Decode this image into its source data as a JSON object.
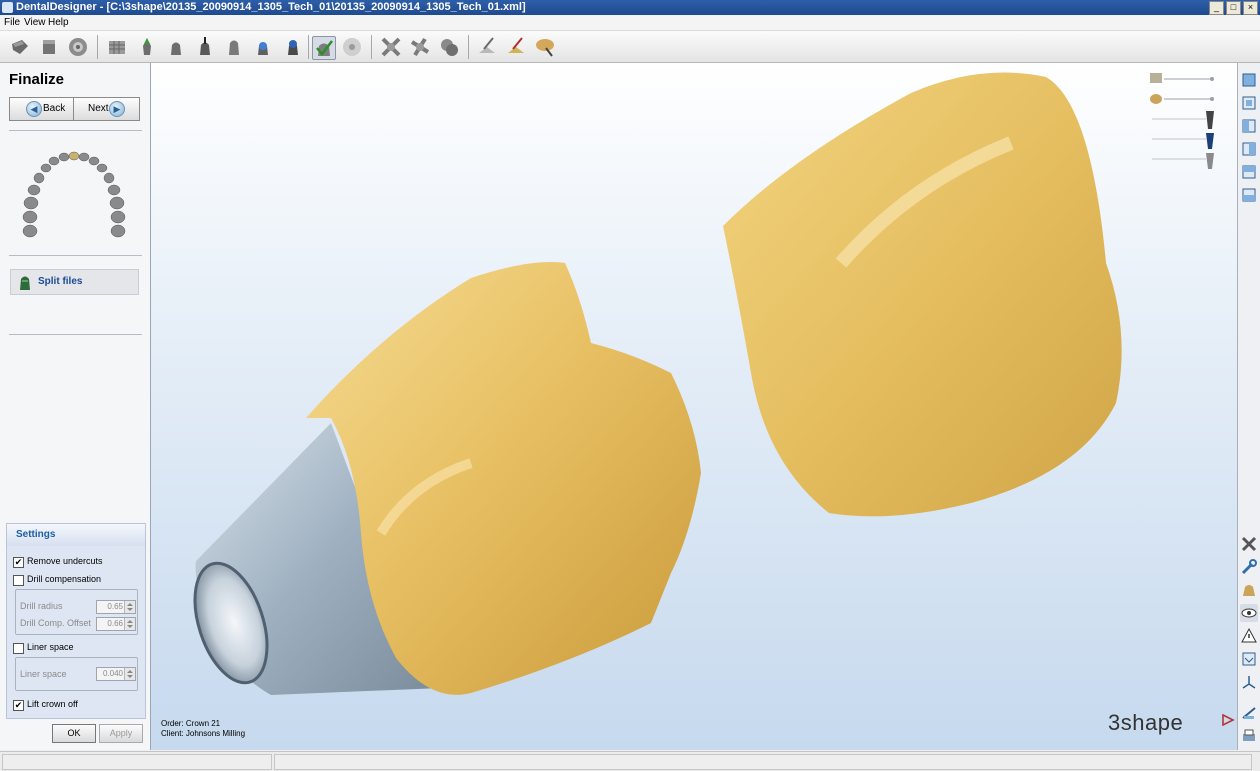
{
  "window": {
    "title": "DentalDesigner - [C:\\3shape\\20135_20090914_1305_Tech_01\\20135_20090914_1305_Tech_01.xml]",
    "buttons": [
      "_",
      "□",
      "×"
    ]
  },
  "menu": [
    "File",
    "View",
    "Help"
  ],
  "toolbar": {
    "icons": [
      "order-icon",
      "model-icon",
      "scan-icon",
      "grid-icon",
      "margin-icon",
      "die-icon",
      "insertion-icon",
      "coping-icon",
      "abutment-icon",
      "cap-icon",
      "finalize-check-icon",
      "disc-icon",
      "gear-icon-1",
      "gear-icon-2",
      "gear-icon-3",
      "tool-icon-1",
      "tool-icon-2",
      "tool-icon-3"
    ]
  },
  "left_panel": {
    "title": "Finalize",
    "back_label": "Back",
    "next_label": "Next",
    "split_files_label": "Split files"
  },
  "settings": {
    "title": "Settings",
    "remove_undercuts": {
      "label": "Remove undercuts",
      "checked": true
    },
    "drill_compensation": {
      "label": "Drill compensation",
      "checked": false
    },
    "drill_radius": {
      "label": "Drill radius",
      "value": "0.65"
    },
    "drill_comp_offset": {
      "label": "Drill Comp. Offset",
      "value": "0.66"
    },
    "liner_space_check": {
      "label": "Liner space",
      "checked": false
    },
    "liner_space": {
      "label": "Liner space",
      "value": "0.040"
    },
    "lift_crown_off": {
      "label": "Lift crown off",
      "checked": true
    },
    "ok_label": "OK",
    "apply_label": "Apply"
  },
  "viewport": {
    "info_line_1": "Order: Crown 21",
    "info_line_2": "Client: Johnsons Milling",
    "logo": "3shape"
  },
  "colors": {
    "crown": "#e8c064",
    "abutment": "#9eb0c0",
    "accent": "#1b5ea8"
  },
  "right_toolbar": {
    "icons": [
      "view-front-icon",
      "view-back-icon",
      "view-left-icon",
      "view-right-icon",
      "view-top-icon",
      "view-bottom-icon",
      "zoom-fit-icon",
      "wrench-icon",
      "model-view-icon",
      "eye-icon",
      "warning-icon",
      "section-icon",
      "axis-icon",
      "measure-icon",
      "print-icon"
    ]
  }
}
